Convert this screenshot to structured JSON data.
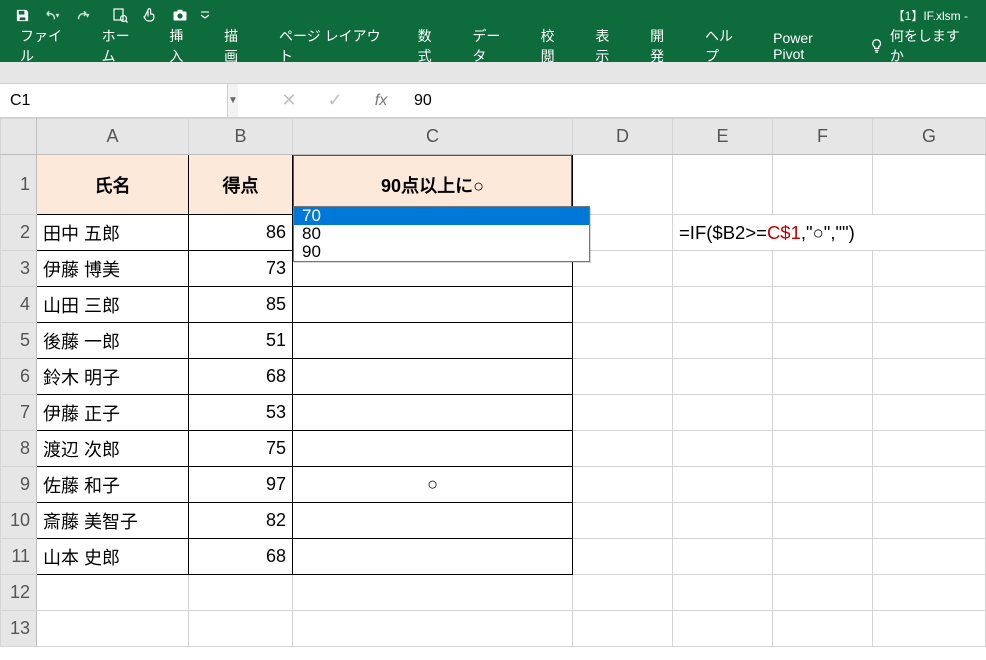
{
  "title_filename": "【1】IF.xlsm  -",
  "qat": {
    "save": "save-icon",
    "undo": "undo-icon",
    "redo": "redo-icon",
    "preview": "print-preview-icon",
    "touch": "touch-mode-icon",
    "camera": "camera-icon"
  },
  "tabs": {
    "file": "ファイル",
    "home": "ホーム",
    "insert": "挿入",
    "draw": "描画",
    "layout": "ページ レイアウト",
    "formulas": "数式",
    "data": "データ",
    "review": "校閲",
    "view": "表示",
    "developer": "開発",
    "help": "ヘルプ",
    "powerpivot": "Power Pivot",
    "tellme": "何をしますか"
  },
  "namebox_value": "C1",
  "formula_value": "90",
  "col_headers": [
    "A",
    "B",
    "C",
    "D",
    "E",
    "F",
    "G"
  ],
  "row_headers": [
    "1",
    "2",
    "3",
    "4",
    "5",
    "6",
    "7",
    "8",
    "9",
    "10",
    "11",
    "12",
    "13"
  ],
  "table": {
    "header": {
      "name": "氏名",
      "score": "得点",
      "mark": "90点以上に○"
    },
    "rows": [
      {
        "name": "田中 五郎",
        "score": "86",
        "mark": ""
      },
      {
        "name": "伊藤 博美",
        "score": "73",
        "mark": ""
      },
      {
        "name": "山田 三郎",
        "score": "85",
        "mark": ""
      },
      {
        "name": "後藤 一郎",
        "score": "51",
        "mark": ""
      },
      {
        "name": "鈴木 明子",
        "score": "68",
        "mark": ""
      },
      {
        "name": "伊藤 正子",
        "score": "53",
        "mark": ""
      },
      {
        "name": "渡辺 次郎",
        "score": "75",
        "mark": ""
      },
      {
        "name": "佐藤 和子",
        "score": "97",
        "mark": "○"
      },
      {
        "name": "斎藤 美智子",
        "score": "82",
        "mark": ""
      },
      {
        "name": "山本 史郎",
        "score": "68",
        "mark": ""
      }
    ]
  },
  "dropdown": {
    "options": [
      "70",
      "80",
      "90"
    ],
    "selected_index": 0
  },
  "e2": {
    "pre": "=IF($B2>=",
    "ref": "C$1",
    "post": ",\"○\",\"\")"
  },
  "colors": {
    "accent": "#0e6b3c",
    "select_blue": "#0078d7",
    "hdr_fill": "#fce9da",
    "ref_red": "#c00000"
  }
}
